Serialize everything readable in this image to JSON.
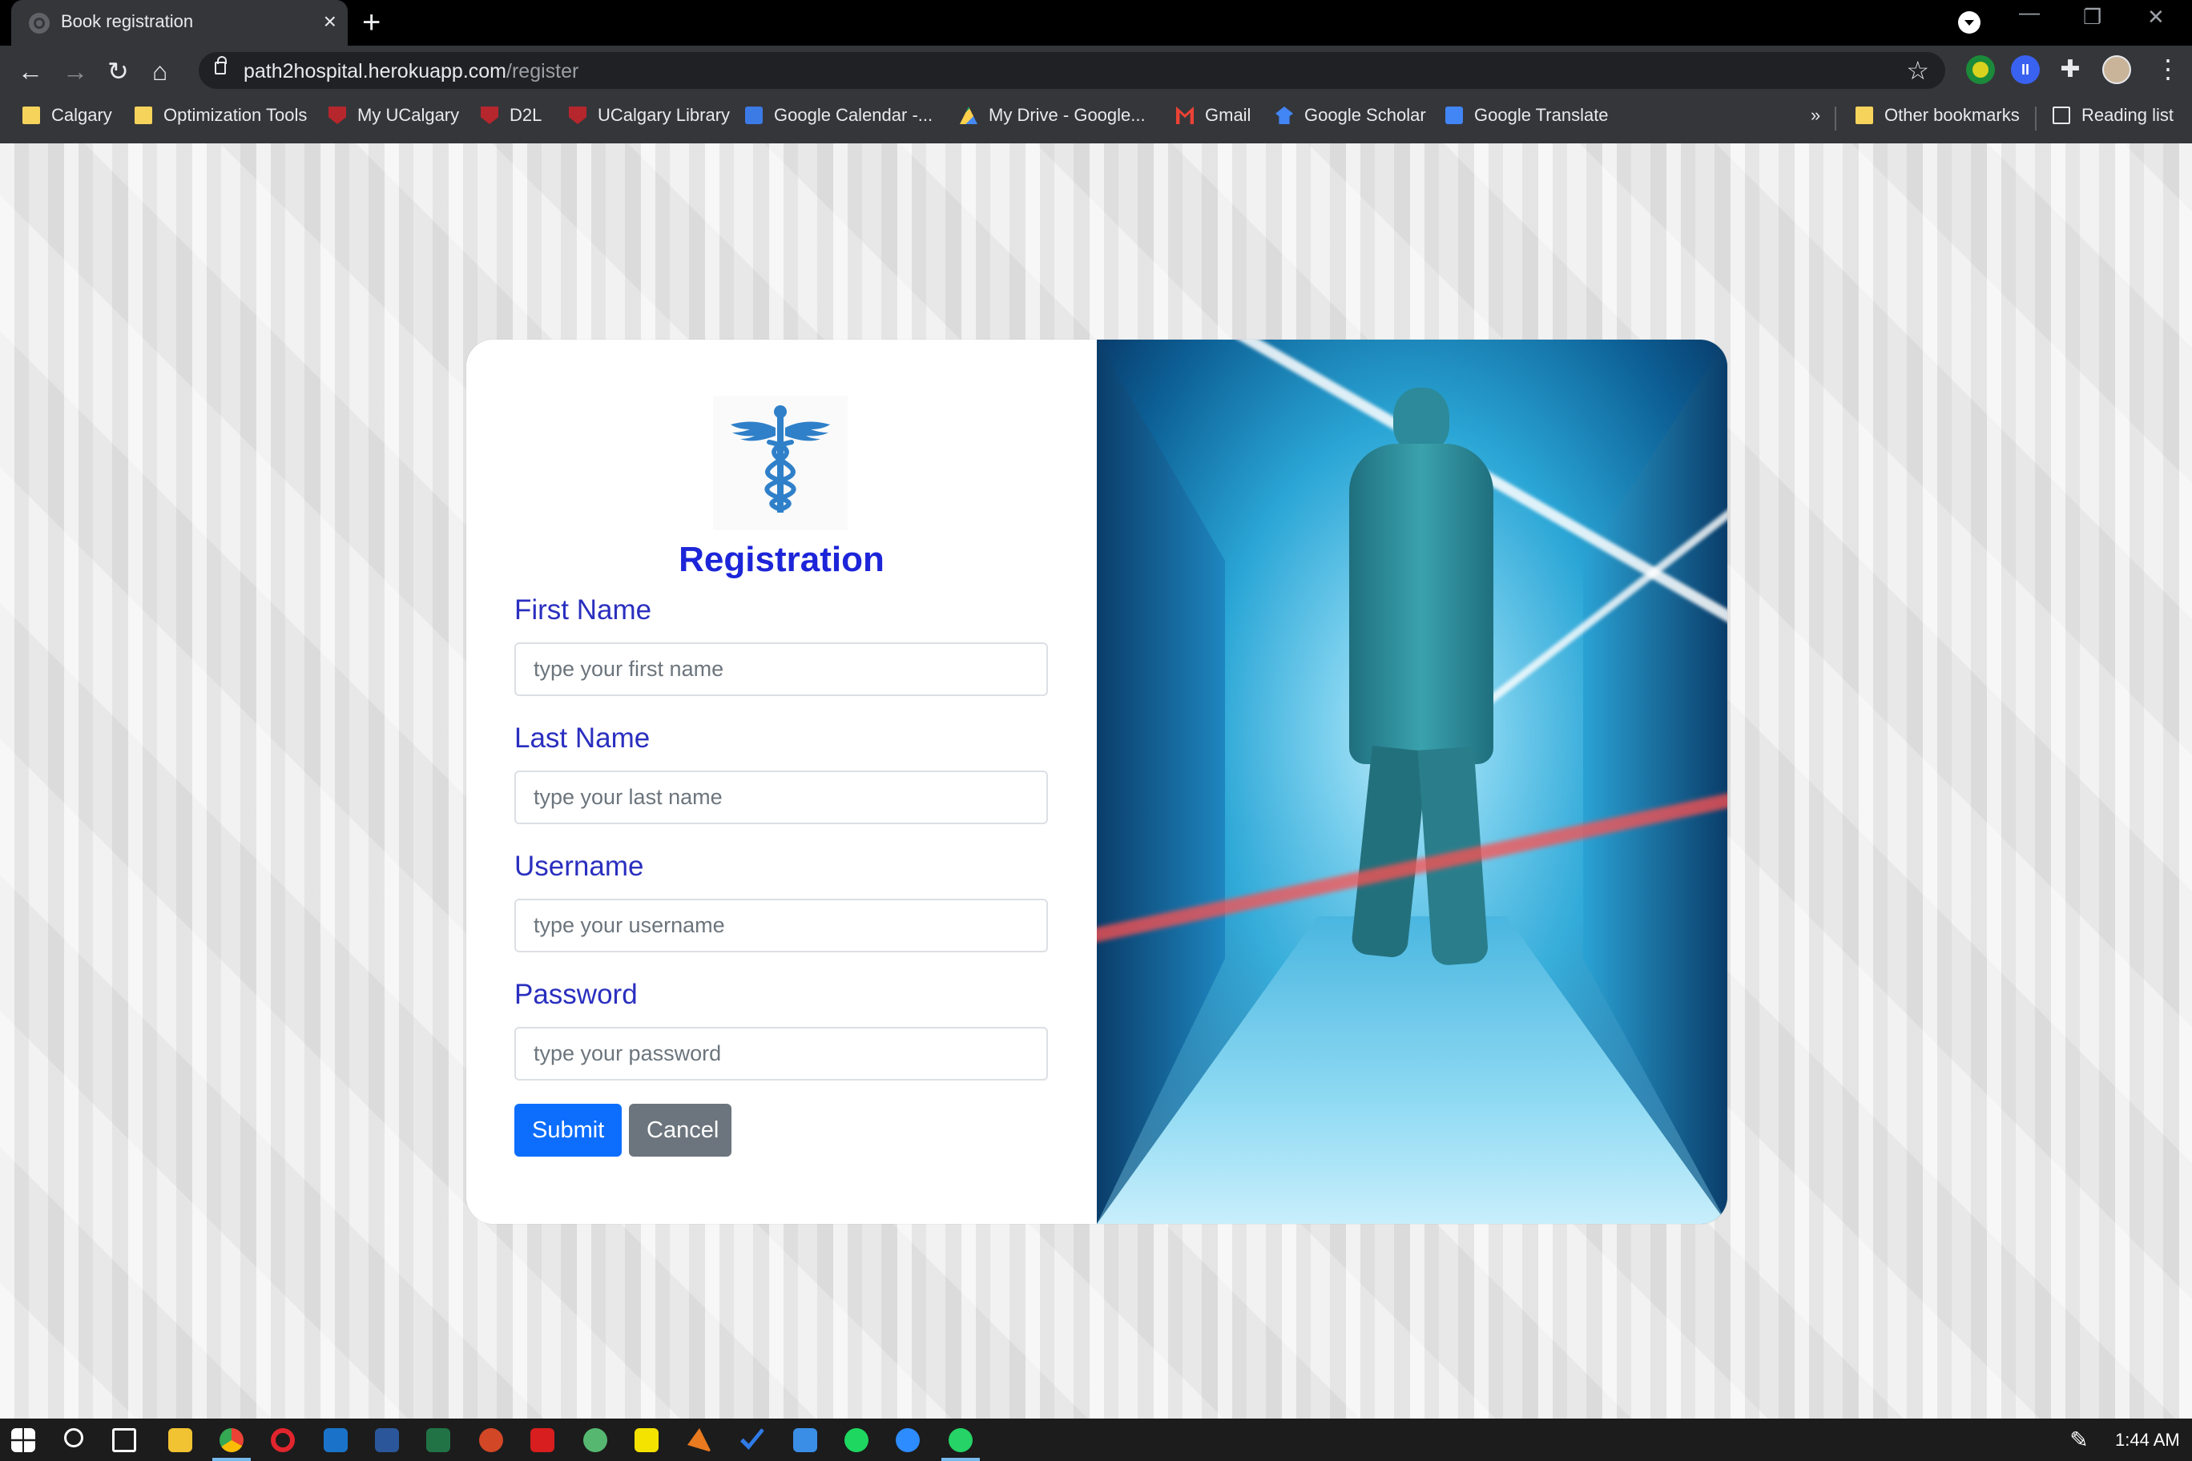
{
  "browser": {
    "tab_title": "Book registration",
    "tab_close": "×",
    "new_tab": "+",
    "url_host": "path2hospital.herokuapp.com",
    "url_path": "/register",
    "window_controls": {
      "minimize": "—",
      "restore": "❐",
      "close": "✕"
    }
  },
  "bookmarks": {
    "items": [
      {
        "label": "Calgary",
        "icon": "folder-icon"
      },
      {
        "label": "Optimization Tools",
        "icon": "folder-icon"
      },
      {
        "label": "My UCalgary",
        "icon": "ucalgary-shield-icon"
      },
      {
        "label": "D2L",
        "icon": "ucalgary-shield-icon"
      },
      {
        "label": "UCalgary Library",
        "icon": "ucalgary-shield-icon"
      },
      {
        "label": "Google Calendar -...",
        "icon": "google-calendar-icon"
      },
      {
        "label": "My Drive - Google...",
        "icon": "google-drive-icon"
      },
      {
        "label": "Gmail",
        "icon": "gmail-icon"
      },
      {
        "label": "Google Scholar",
        "icon": "google-scholar-icon"
      },
      {
        "label": "Google Translate",
        "icon": "google-translate-icon"
      }
    ],
    "more": "»",
    "other_bookmarks": "Other bookmarks",
    "reading_list": "Reading list"
  },
  "form": {
    "heading": "Registration",
    "logo_icon": "caduceus-icon",
    "first_name_label": "First Name",
    "first_name_placeholder": "type your first name",
    "last_name_label": "Last Name",
    "last_name_placeholder": "type your last name",
    "username_label": "Username",
    "username_placeholder": "type your username",
    "password_label": "Password",
    "password_placeholder": "type your password",
    "submit_label": "Submit",
    "cancel_label": "Cancel"
  },
  "colors": {
    "heading": "#1c25d8",
    "label": "#2a2fbf",
    "submit_bg": "#0d6efd",
    "cancel_bg": "#6c757d",
    "logo": "#2f80c9"
  },
  "taskbar": {
    "clock": "1:44 AM"
  }
}
